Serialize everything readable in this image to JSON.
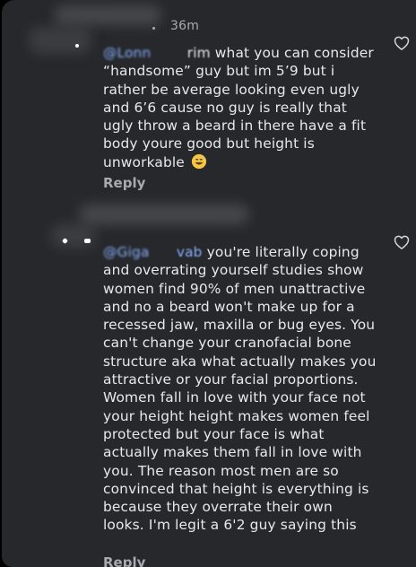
{
  "comment1": {
    "time": "36m",
    "mention": "@Lonn",
    "mention_tail": "rim",
    "text": " what you can consider “handsome” guy but im 5’9 but i rather be average looking even ugly and 6’6 cause no guy is really that ugly throw a beard in there have a fit body youre good but height is unworkable",
    "emoji": "grinning-sweat-emoji",
    "reply_label": "Reply"
  },
  "comment2": {
    "mention": "@Giga",
    "mention_tail": "vab",
    "text": " you're literally coping and overrating yourself studies show women find 90% of men unattractive and no a beard won't make up for a recessed jaw, maxilla or bug eyes. You can't change your cranofacial bone structure aka what actually makes you attractive or your facial proportions. Women fall in love with your face not your height height makes women feel protected but your face is what actually makes them fall in love with you. The reason most men are so convinced that height is everything is because they overrate their own looks. I'm legit a 6'2 guy saying this",
    "reply_label": "Reply"
  },
  "icons": {
    "like": "heart-outline-icon"
  },
  "colors": {
    "background": "#26282b",
    "text": "#e8e9eb",
    "muted": "#a7aab0",
    "mention": "#8ab0ff"
  }
}
